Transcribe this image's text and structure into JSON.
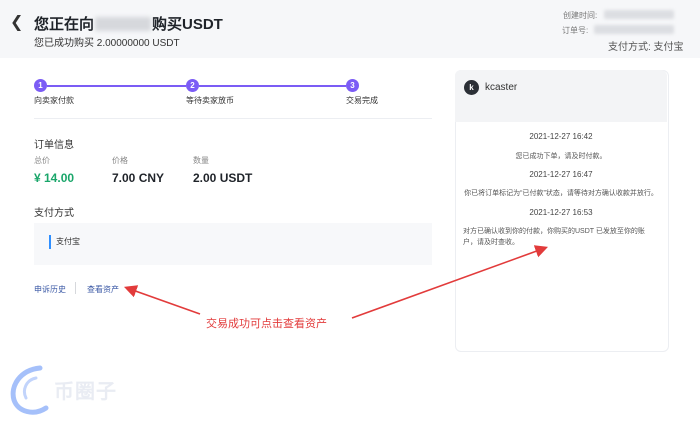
{
  "header": {
    "title_prefix": "您正在向",
    "title_suffix": "购买USDT",
    "subtitle": "您已成功购买 2.00000000 USDT",
    "created_label": "创建时间:",
    "order_label": "订单号:",
    "pay_method": "支付方式: 支付宝"
  },
  "steps": [
    {
      "num": "1",
      "label": "向卖家付款"
    },
    {
      "num": "2",
      "label": "等待卖家放币"
    },
    {
      "num": "3",
      "label": "交易完成"
    }
  ],
  "order": {
    "section_title": "订单信息",
    "cols": [
      {
        "label": "总价",
        "value": "¥ 14.00"
      },
      {
        "label": "价格",
        "value": "7.00 CNY"
      },
      {
        "label": "数量",
        "value": "2.00 USDT"
      }
    ]
  },
  "payment": {
    "section_title": "支付方式",
    "method": "支付宝"
  },
  "links": {
    "appeal_history": "申诉历史",
    "view_assets": "查看资产"
  },
  "chat": {
    "avatar_letter": "k",
    "name": "kcaster",
    "messages": [
      {
        "time": "2021-12-27 16:42",
        "text": "您已成功下单，请及时付款。"
      },
      {
        "time": "2021-12-27 16:47",
        "text": "你已将订单标记为“已付款”状态，请等待对方确认收款并放行。"
      },
      {
        "time": "2021-12-27 16:53",
        "text": "对方已确认收到你的付款，你购买的USDT 已发放至你的账户，请及时查收。"
      }
    ]
  },
  "annotation": "交易成功可点击查看资产",
  "watermark": "币圈子",
  "colors": {
    "accent": "#7b5cf5",
    "price_green": "#1aa66a",
    "annotation_red": "#e23b3b",
    "link_blue": "#3c5aa6"
  }
}
